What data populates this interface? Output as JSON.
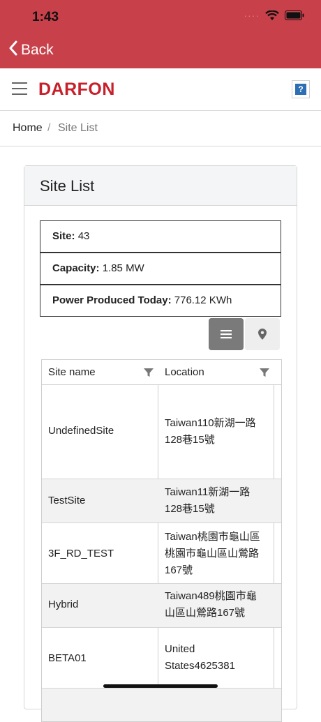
{
  "status": {
    "time": "1:43"
  },
  "nav": {
    "back_label": "Back"
  },
  "header": {
    "logo": "DARFON",
    "help_label": "?"
  },
  "breadcrumb": {
    "home": "Home",
    "separator": "/",
    "current": "Site List"
  },
  "card": {
    "title": "Site List"
  },
  "summary": {
    "site_label": "Site:",
    "site_value": "43",
    "capacity_label": "Capacity:",
    "capacity_value": "1.85 MW",
    "power_label": "Power Produced Today:",
    "power_value": "776.12 KWh"
  },
  "table": {
    "columns": [
      "Site name",
      "Location"
    ],
    "rows": [
      {
        "site": "UndefinedSite",
        "loc1": "Taiwan110新湖一路",
        "loc2": "128巷15號",
        "loc3": ""
      },
      {
        "site": "TestSite",
        "loc1": "Taiwan11新湖一路",
        "loc2": "128巷15號",
        "loc3": ""
      },
      {
        "site": "3F_RD_TEST",
        "loc1": "Taiwan桃園市龜山區",
        "loc2": "桃園市龜山區山鶯路",
        "loc3": "167號"
      },
      {
        "site": "Hybrid",
        "loc1": "Taiwan489桃園市龜",
        "loc2": "山區山鶯路167號",
        "loc3": ""
      },
      {
        "site": "BETA01",
        "loc1": "United",
        "loc2": "States4625381",
        "loc3": ""
      }
    ]
  },
  "colors": {
    "brand_red": "#c8404a",
    "logo_red": "#c8202a",
    "help_blue": "#2c6fb5"
  }
}
